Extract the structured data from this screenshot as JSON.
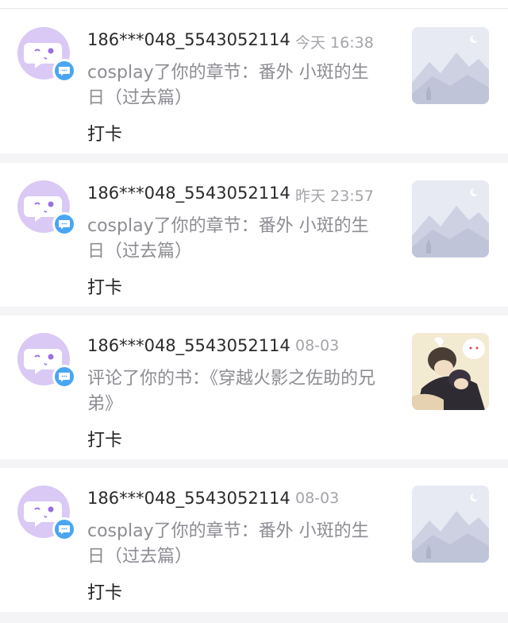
{
  "notifications": [
    {
      "username": "186***048_5543052114",
      "time": "今天 16:38",
      "action": "cosplay了你的章节：番外 小斑的生日（过去篇）",
      "reply": "打卡",
      "thumbnail": "placeholder-landscape-image"
    },
    {
      "username": "186***048_5543052114",
      "time": "昨天 23:57",
      "action": "cosplay了你的章节：番外 小斑的生日（过去篇）",
      "reply": "打卡",
      "thumbnail": "placeholder-landscape-image"
    },
    {
      "username": "186***048_5543052114",
      "time": "08-03",
      "action": "评论了你的书：《穿越火影之佐助的兄弟》",
      "reply": "打卡",
      "thumbnail": "book-cover-image"
    },
    {
      "username": "186***048_5543052114",
      "time": "08-03",
      "action": "cosplay了你的章节：番外 小斑的生日（过去篇）",
      "reply": "打卡",
      "thumbnail": "placeholder-landscape-image"
    }
  ],
  "icons": {
    "avatar": "chat-bubble-avatar-icon",
    "badge": "message-badge-icon"
  },
  "colors": {
    "avatar_bg": "#d9c9f4",
    "avatar_glyph": "#9a6fe0",
    "badge": "#4aa6f1",
    "time_text": "#a4a4aa",
    "action_text": "#8c8c93"
  }
}
